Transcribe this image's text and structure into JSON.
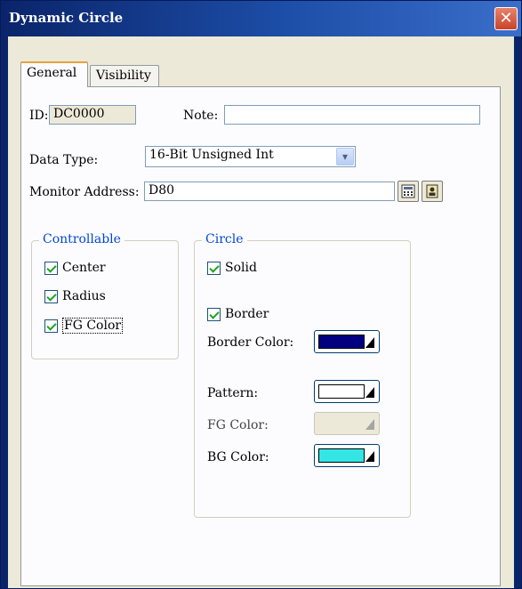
{
  "window": {
    "title": "Dynamic Circle",
    "close_glyph": "✕"
  },
  "tabs": [
    {
      "label": "General",
      "active": true
    },
    {
      "label": "Visibility",
      "active": false
    }
  ],
  "general": {
    "id_label": "ID:",
    "id_value": "DC0000",
    "note_label": "Note:",
    "note_value": "",
    "data_type_label": "Data Type:",
    "data_type_value": "16-Bit Unsigned Int",
    "monitor_address_label": "Monitor Address:",
    "monitor_address_value": "D80",
    "icons": [
      "calculator-icon",
      "address-book-icon"
    ]
  },
  "controllable": {
    "title": "Controllable",
    "items": [
      {
        "label": "Center",
        "checked": true
      },
      {
        "label": "Radius",
        "checked": true
      },
      {
        "label": "FG Color",
        "checked": true
      }
    ]
  },
  "circle": {
    "title": "Circle",
    "solid_label": "Solid",
    "solid_checked": true,
    "border_label": "Border",
    "border_checked": true,
    "border_color_label": "Border Color:",
    "border_color": "#000080",
    "pattern_label": "Pattern:",
    "pattern_color": "#ffffff",
    "fg_color_label": "FG Color:",
    "fg_color_enabled": false,
    "bg_color_label": "BG Color:",
    "bg_color": "#33e5e5"
  },
  "colors": {
    "title_bar": "#0a246a",
    "dialog_face": "#ece9d8",
    "group_title": "#0046d5",
    "tab_highlight": "#e6a23c"
  }
}
